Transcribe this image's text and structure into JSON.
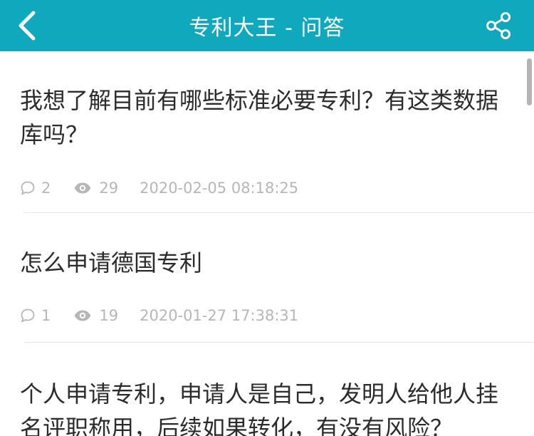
{
  "header": {
    "title": "专利大王 - 问答"
  },
  "questions": [
    {
      "title": "我想了解目前有哪些标准必要专利？有这类数据库吗？",
      "comments": "2",
      "views": "29",
      "time": "2020-02-05 08:18:25"
    },
    {
      "title": "怎么申请德国专利",
      "comments": "1",
      "views": "19",
      "time": "2020-01-27 17:38:31"
    },
    {
      "title": "个人申请专利，申请人是自己，发明人给他人挂名评职称用，后续如果转化，有没有风险？"
    }
  ],
  "icons": {
    "back": "chevron-left-icon",
    "share": "share-icon",
    "comment": "comment-icon",
    "views": "eye-icon"
  },
  "colors": {
    "header": "#0fa8bd",
    "title_text": "#2b2b2b",
    "meta_text": "#b6b6b6"
  }
}
